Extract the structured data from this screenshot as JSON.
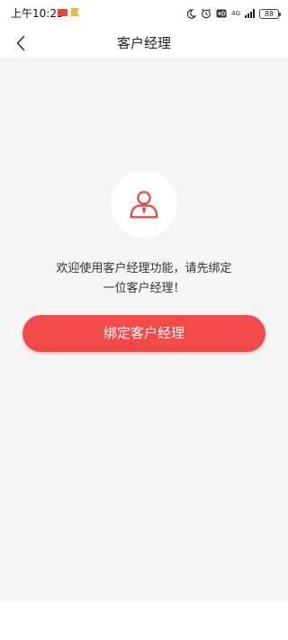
{
  "status_bar": {
    "time": "上午10:25",
    "network": "4G",
    "battery": "88",
    "icons": [
      "message-notification-icon",
      "flag-notification-icon",
      "moon-icon",
      "alarm-icon",
      "hd-icon",
      "signal-icon",
      "battery-icon"
    ]
  },
  "nav": {
    "title": "客户经理",
    "back_icon": "chevron-left-icon"
  },
  "main": {
    "avatar_icon": "manager-person-icon",
    "message_line1": "欢迎使用客户经理功能，请先绑定",
    "message_line2": "一位客户经理！",
    "bind_button_label": "绑定客户经理"
  },
  "colors": {
    "accent": "#f04848",
    "icon_red": "#e54a45",
    "background": "#f5f5f5"
  }
}
